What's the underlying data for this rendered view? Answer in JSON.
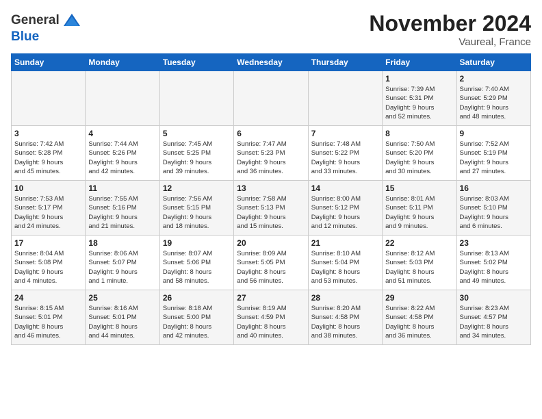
{
  "logo": {
    "general": "General",
    "blue": "Blue"
  },
  "header": {
    "month_year": "November 2024",
    "location": "Vaureal, France"
  },
  "weekdays": [
    "Sunday",
    "Monday",
    "Tuesday",
    "Wednesday",
    "Thursday",
    "Friday",
    "Saturday"
  ],
  "weeks": [
    [
      {
        "day": "",
        "info": ""
      },
      {
        "day": "",
        "info": ""
      },
      {
        "day": "",
        "info": ""
      },
      {
        "day": "",
        "info": ""
      },
      {
        "day": "",
        "info": ""
      },
      {
        "day": "1",
        "info": "Sunrise: 7:39 AM\nSunset: 5:31 PM\nDaylight: 9 hours\nand 52 minutes."
      },
      {
        "day": "2",
        "info": "Sunrise: 7:40 AM\nSunset: 5:29 PM\nDaylight: 9 hours\nand 48 minutes."
      }
    ],
    [
      {
        "day": "3",
        "info": "Sunrise: 7:42 AM\nSunset: 5:28 PM\nDaylight: 9 hours\nand 45 minutes."
      },
      {
        "day": "4",
        "info": "Sunrise: 7:44 AM\nSunset: 5:26 PM\nDaylight: 9 hours\nand 42 minutes."
      },
      {
        "day": "5",
        "info": "Sunrise: 7:45 AM\nSunset: 5:25 PM\nDaylight: 9 hours\nand 39 minutes."
      },
      {
        "day": "6",
        "info": "Sunrise: 7:47 AM\nSunset: 5:23 PM\nDaylight: 9 hours\nand 36 minutes."
      },
      {
        "day": "7",
        "info": "Sunrise: 7:48 AM\nSunset: 5:22 PM\nDaylight: 9 hours\nand 33 minutes."
      },
      {
        "day": "8",
        "info": "Sunrise: 7:50 AM\nSunset: 5:20 PM\nDaylight: 9 hours\nand 30 minutes."
      },
      {
        "day": "9",
        "info": "Sunrise: 7:52 AM\nSunset: 5:19 PM\nDaylight: 9 hours\nand 27 minutes."
      }
    ],
    [
      {
        "day": "10",
        "info": "Sunrise: 7:53 AM\nSunset: 5:17 PM\nDaylight: 9 hours\nand 24 minutes."
      },
      {
        "day": "11",
        "info": "Sunrise: 7:55 AM\nSunset: 5:16 PM\nDaylight: 9 hours\nand 21 minutes."
      },
      {
        "day": "12",
        "info": "Sunrise: 7:56 AM\nSunset: 5:15 PM\nDaylight: 9 hours\nand 18 minutes."
      },
      {
        "day": "13",
        "info": "Sunrise: 7:58 AM\nSunset: 5:13 PM\nDaylight: 9 hours\nand 15 minutes."
      },
      {
        "day": "14",
        "info": "Sunrise: 8:00 AM\nSunset: 5:12 PM\nDaylight: 9 hours\nand 12 minutes."
      },
      {
        "day": "15",
        "info": "Sunrise: 8:01 AM\nSunset: 5:11 PM\nDaylight: 9 hours\nand 9 minutes."
      },
      {
        "day": "16",
        "info": "Sunrise: 8:03 AM\nSunset: 5:10 PM\nDaylight: 9 hours\nand 6 minutes."
      }
    ],
    [
      {
        "day": "17",
        "info": "Sunrise: 8:04 AM\nSunset: 5:08 PM\nDaylight: 9 hours\nand 4 minutes."
      },
      {
        "day": "18",
        "info": "Sunrise: 8:06 AM\nSunset: 5:07 PM\nDaylight: 9 hours\nand 1 minute."
      },
      {
        "day": "19",
        "info": "Sunrise: 8:07 AM\nSunset: 5:06 PM\nDaylight: 8 hours\nand 58 minutes."
      },
      {
        "day": "20",
        "info": "Sunrise: 8:09 AM\nSunset: 5:05 PM\nDaylight: 8 hours\nand 56 minutes."
      },
      {
        "day": "21",
        "info": "Sunrise: 8:10 AM\nSunset: 5:04 PM\nDaylight: 8 hours\nand 53 minutes."
      },
      {
        "day": "22",
        "info": "Sunrise: 8:12 AM\nSunset: 5:03 PM\nDaylight: 8 hours\nand 51 minutes."
      },
      {
        "day": "23",
        "info": "Sunrise: 8:13 AM\nSunset: 5:02 PM\nDaylight: 8 hours\nand 49 minutes."
      }
    ],
    [
      {
        "day": "24",
        "info": "Sunrise: 8:15 AM\nSunset: 5:01 PM\nDaylight: 8 hours\nand 46 minutes."
      },
      {
        "day": "25",
        "info": "Sunrise: 8:16 AM\nSunset: 5:01 PM\nDaylight: 8 hours\nand 44 minutes."
      },
      {
        "day": "26",
        "info": "Sunrise: 8:18 AM\nSunset: 5:00 PM\nDaylight: 8 hours\nand 42 minutes."
      },
      {
        "day": "27",
        "info": "Sunrise: 8:19 AM\nSunset: 4:59 PM\nDaylight: 8 hours\nand 40 minutes."
      },
      {
        "day": "28",
        "info": "Sunrise: 8:20 AM\nSunset: 4:58 PM\nDaylight: 8 hours\nand 38 minutes."
      },
      {
        "day": "29",
        "info": "Sunrise: 8:22 AM\nSunset: 4:58 PM\nDaylight: 8 hours\nand 36 minutes."
      },
      {
        "day": "30",
        "info": "Sunrise: 8:23 AM\nSunset: 4:57 PM\nDaylight: 8 hours\nand 34 minutes."
      }
    ]
  ]
}
